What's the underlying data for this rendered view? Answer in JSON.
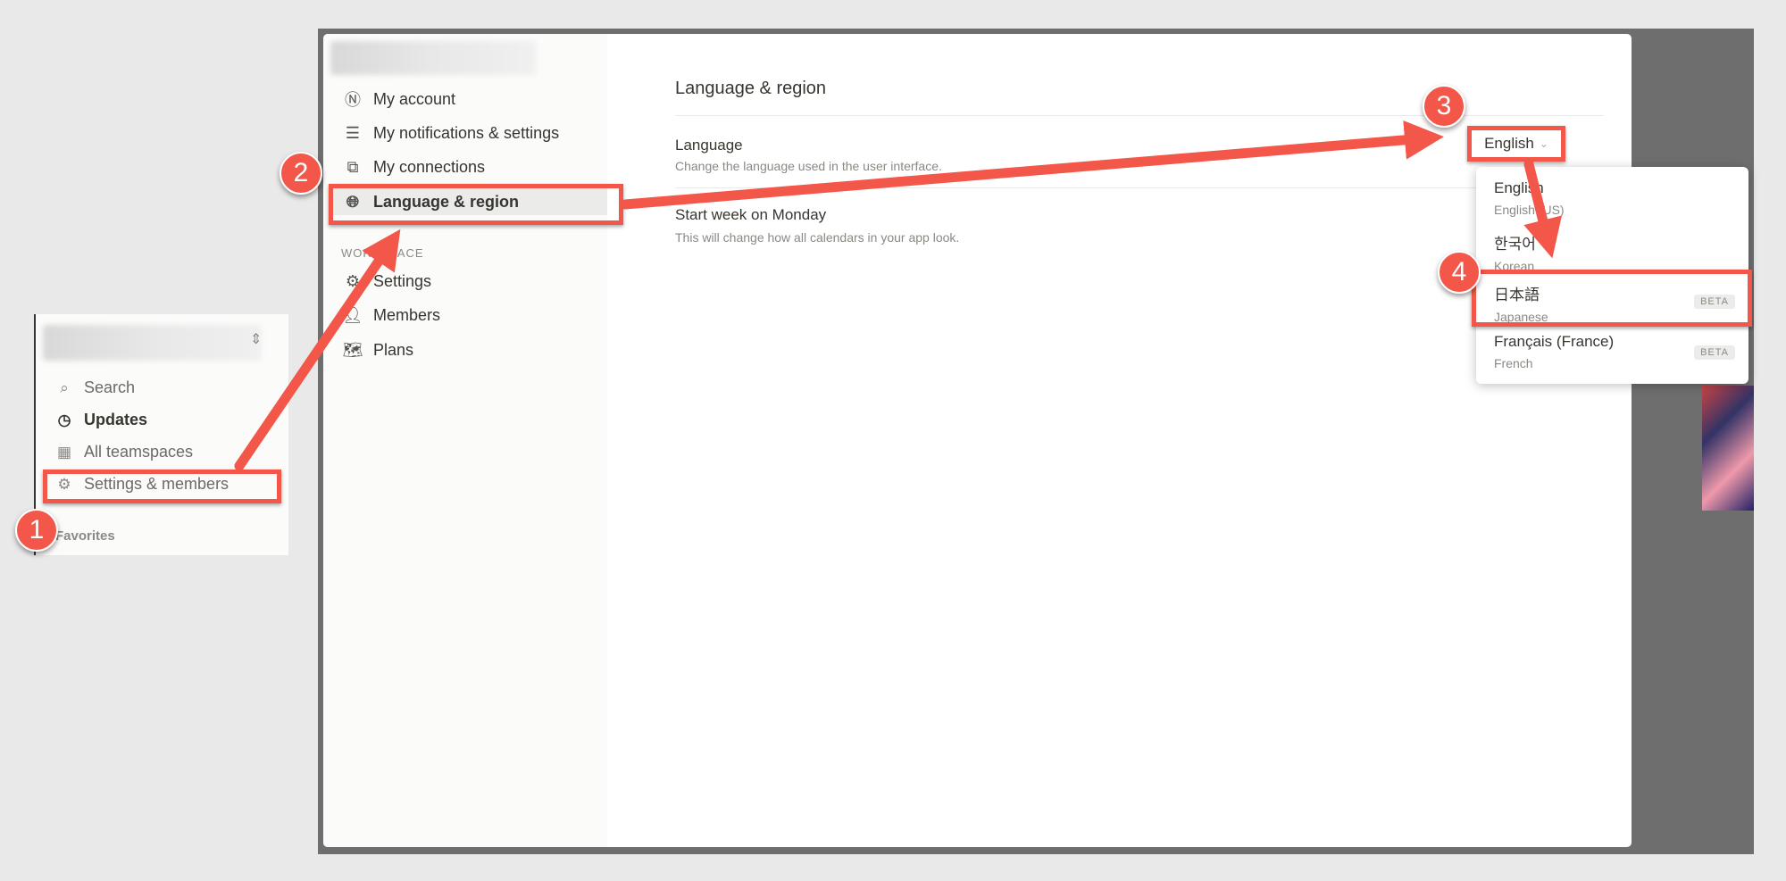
{
  "left_sidebar": {
    "items": [
      {
        "label": "Search",
        "icon": "search-icon"
      },
      {
        "label": "Updates",
        "icon": "clock-icon"
      },
      {
        "label": "All teamspaces",
        "icon": "building-icon"
      },
      {
        "label": "Settings & members",
        "icon": "gear-icon"
      }
    ],
    "section": "Favorites"
  },
  "modal": {
    "sidebar": {
      "items": [
        {
          "label": "My account",
          "icon": "notion-logo-icon"
        },
        {
          "label": "My notifications & settings",
          "icon": "sliders-icon"
        },
        {
          "label": "My connections",
          "icon": "external-link-icon"
        },
        {
          "label": "Language & region",
          "icon": "globe-icon"
        }
      ],
      "workspace_heading": "WORKSPACE",
      "workspace_items": [
        {
          "label": "Settings",
          "icon": "gear-icon"
        },
        {
          "label": "Members",
          "icon": "person-icon"
        },
        {
          "label": "Plans",
          "icon": "map-icon"
        }
      ]
    },
    "title": "Language & region",
    "language": {
      "label": "Language",
      "description": "Change the language used in the user interface.",
      "value": "English"
    },
    "start_week": {
      "label": "Start week on Monday",
      "description": "This will change how all calendars in your app look."
    },
    "dropdown": [
      {
        "name": "English",
        "sub": "English (US)",
        "badge": ""
      },
      {
        "name": "한국어",
        "sub": "Korean",
        "badge": ""
      },
      {
        "name": "日本語",
        "sub": "Japanese",
        "badge": "BETA"
      },
      {
        "name": "Français (France)",
        "sub": "French",
        "badge": "BETA"
      }
    ]
  },
  "annotations": {
    "steps": [
      "1",
      "2",
      "3",
      "4"
    ],
    "color": "#f2574a"
  }
}
